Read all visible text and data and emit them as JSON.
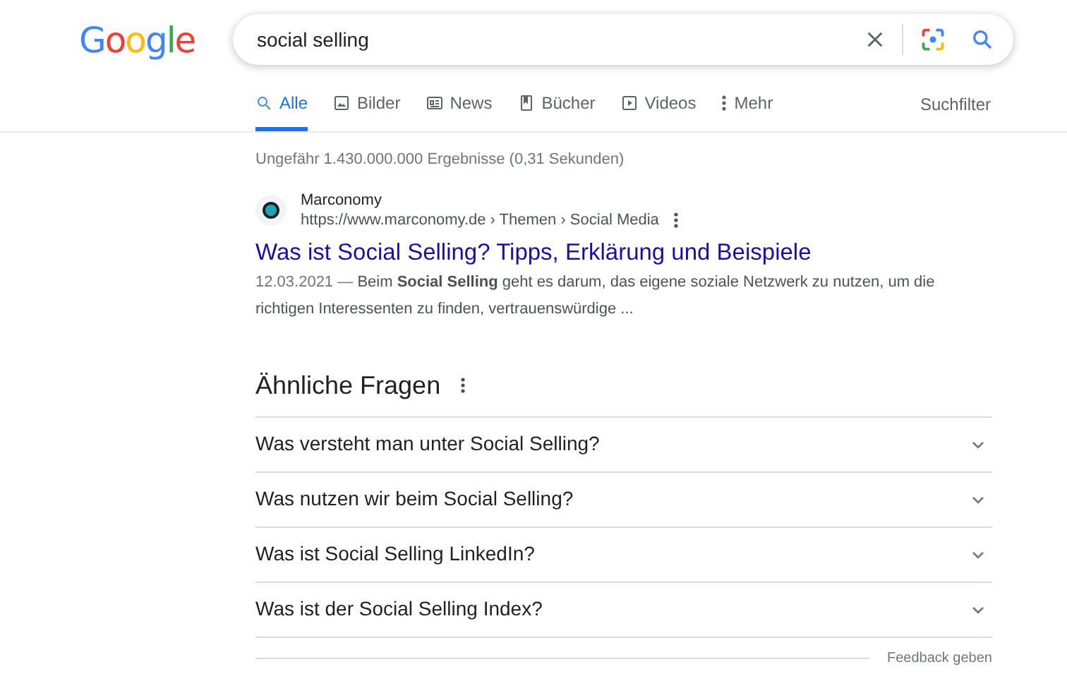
{
  "logo": "Google",
  "search": {
    "value": "social selling"
  },
  "tabs": [
    {
      "label": "Alle",
      "kind": "search",
      "selected": true
    },
    {
      "label": "Bilder",
      "kind": "image",
      "selected": false
    },
    {
      "label": "News",
      "kind": "news",
      "selected": false
    },
    {
      "label": "Bücher",
      "kind": "book",
      "selected": false
    },
    {
      "label": "Videos",
      "kind": "video",
      "selected": false
    },
    {
      "label": "Mehr",
      "kind": "more",
      "selected": false
    }
  ],
  "filter_label": "Suchfilter",
  "result_stats": "Ungefähr 1.430.000.000 Ergebnisse (0,31 Sekunden)",
  "result": {
    "site": "Marconomy",
    "url": "https://www.marconomy.de › Themen › Social Media",
    "title": "Was ist Social Selling? Tipps, Erklärung und Beispiele",
    "date": "12.03.2021",
    "separator": "—",
    "snippet": "Beim **Social Selling** geht es darum, das eigene soziale Netzwerk zu nutzen, um die richtigen Interessenten zu finden, vertrauenswürdige ..."
  },
  "related": {
    "heading": "Ähnliche Fragen",
    "questions": [
      {
        "text": "Was versteht man unter Social Selling?",
        "expanded": false
      },
      {
        "text": "Was nutzen wir beim Social Selling?",
        "expanded": false
      },
      {
        "text": "Was ist Social Selling LinkedIn?",
        "expanded": false
      },
      {
        "text": "Was ist der Social Selling Index?",
        "expanded": false
      }
    ]
  },
  "feedback": "Feedback geben"
}
